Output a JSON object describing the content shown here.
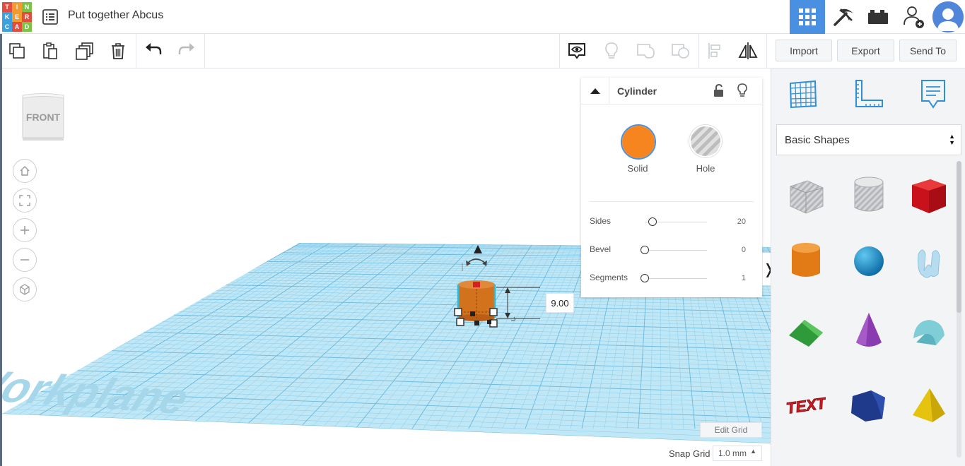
{
  "header": {
    "logo_letters": [
      "T",
      "I",
      "N",
      "K",
      "E",
      "R",
      "C",
      "A",
      "D"
    ],
    "logo_colors": [
      "#e44c3f",
      "#f29a30",
      "#7cc243",
      "#3aa0e0",
      "#f29a30",
      "#e44c3f",
      "#3aa0e0",
      "#e44c3f",
      "#7cc243"
    ],
    "design_title": "Put together Abcus",
    "accent_color": "#4a90e2",
    "buttons": [
      "grid-view-icon",
      "pickaxe-icon",
      "bricks-icon",
      "add-user-icon"
    ]
  },
  "toolbar": {
    "tools": [
      "copy-icon",
      "paste-icon",
      "duplicate-icon",
      "delete-icon",
      "undo-icon",
      "redo-icon"
    ],
    "right_tools": [
      "notes-icon",
      "lightbulb-icon",
      "group-icon",
      "ungroup-icon",
      "align-icon",
      "mirror-icon"
    ],
    "import_label": "Import",
    "export_label": "Export",
    "send_to_label": "Send To"
  },
  "viewport": {
    "viewcube_label": "FRONT",
    "nav_buttons": [
      "home-icon",
      "fit-view-icon",
      "zoom-in-icon",
      "zoom-out-icon",
      "perspective-icon"
    ],
    "workplane_label": "Workplane",
    "dimension_value": "9.00",
    "edit_grid_label": "Edit Grid",
    "snap_grid_label": "Snap Grid",
    "snap_grid_value": "1.0 mm"
  },
  "inspector": {
    "title": "Cylinder",
    "solid_label": "Solid",
    "hole_label": "Hole",
    "solid_color": "#f7851f",
    "props": [
      {
        "label": "Sides",
        "value": "20",
        "fraction": 0.13
      },
      {
        "label": "Bevel",
        "value": "0",
        "fraction": 0.0
      },
      {
        "label": "Segments",
        "value": "1",
        "fraction": 0.0
      }
    ]
  },
  "shapes_panel": {
    "tabs": [
      "workplane-grid-icon",
      "ruler-icon",
      "notes-panel-icon"
    ],
    "category": "Basic Shapes",
    "shapes": [
      "box-hole-icon",
      "cylinder-hole-icon",
      "box-icon",
      "cylinder-icon",
      "sphere-icon",
      "scribble-icon",
      "roof-icon",
      "cone-icon",
      "round-roof-icon",
      "text-icon",
      "prism-icon",
      "pyramid-icon"
    ],
    "shape_text_sample": "TEXT"
  }
}
